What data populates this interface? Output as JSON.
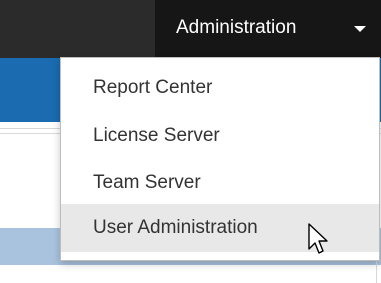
{
  "topbar": {
    "admin_menu": {
      "label": "Administration",
      "caret_icon": "caret-down-icon"
    }
  },
  "dropdown": {
    "items": [
      {
        "label": "Report Center"
      },
      {
        "label": "License Server"
      },
      {
        "label": "Team Server"
      },
      {
        "label": "User Administration",
        "hovered": true
      }
    ]
  },
  "colors": {
    "topbar": "#2b2b2b",
    "admin_toggle": "#161616",
    "blue_band": "#1a6baf",
    "hover_bg": "#e8e8e8",
    "light_row": "#a9c3de"
  },
  "cursor_icon": "hand-pointer-icon"
}
